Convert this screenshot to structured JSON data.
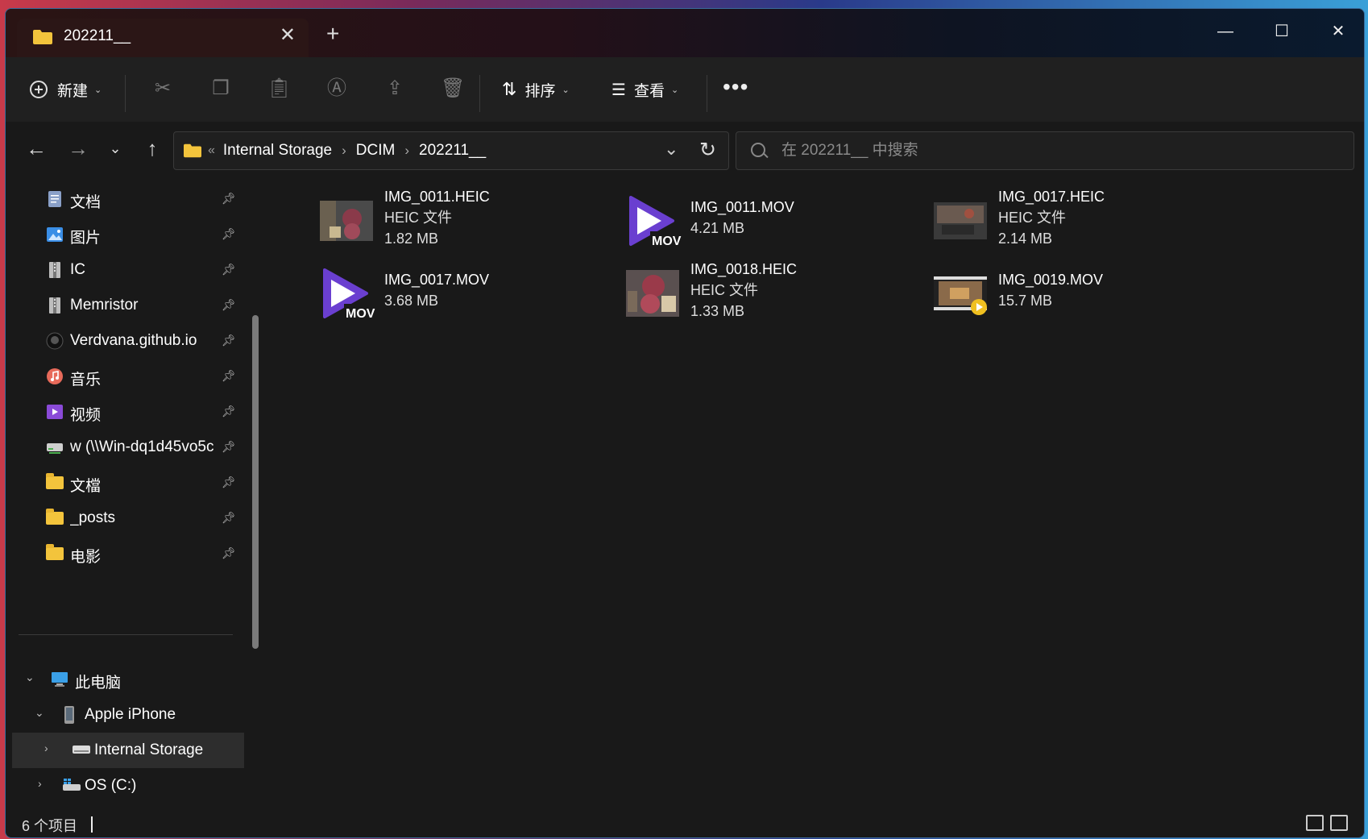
{
  "window": {
    "tab_title": "202211__",
    "new_tab_label": "+",
    "close_tab_label": "✕",
    "minimize_label": "—",
    "maximize_label": "☐",
    "close_label": "✕"
  },
  "toolbar": {
    "new_label": "新建",
    "sort_label": "排序",
    "view_label": "查看",
    "more_label": "•••",
    "icons": [
      "cut-icon",
      "copy-icon",
      "paste-icon",
      "rename-icon",
      "share-icon",
      "delete-icon"
    ]
  },
  "address": {
    "overflow": "«",
    "crumbs": [
      "Internal Storage",
      "DCIM",
      "202211__"
    ],
    "sep": "›"
  },
  "search": {
    "placeholder": "在 202211__ 中搜索"
  },
  "sidebar": {
    "quick_access": [
      {
        "label": "文档",
        "icon": "documents-icon"
      },
      {
        "label": "图片",
        "icon": "pictures-icon"
      },
      {
        "label": "IC",
        "icon": "zip-icon"
      },
      {
        "label": "Memristor",
        "icon": "zip-icon"
      },
      {
        "label": "Verdvana.github.io",
        "icon": "github-icon"
      },
      {
        "label": "音乐",
        "icon": "music-icon"
      },
      {
        "label": "视频",
        "icon": "videos-icon"
      },
      {
        "label": "w (\\\\Win-dq1d45vo5c",
        "icon": "network-drive-icon"
      },
      {
        "label": "文檔",
        "icon": "folder-icon"
      },
      {
        "label": "_posts",
        "icon": "folder-icon"
      },
      {
        "label": "电影",
        "icon": "folder-icon"
      }
    ],
    "tree": {
      "this_pc": "此电脑",
      "device": "Apple iPhone",
      "storage": "Internal Storage",
      "os": "OS (C:)"
    }
  },
  "files": [
    {
      "name": "IMG_0011.HEIC",
      "type": "HEIC 文件",
      "size": "1.82 MB",
      "kind": "image"
    },
    {
      "name": "IMG_0011.MOV",
      "type": "",
      "size": "4.21 MB",
      "kind": "mov"
    },
    {
      "name": "IMG_0017.HEIC",
      "type": "HEIC 文件",
      "size": "2.14 MB",
      "kind": "image"
    },
    {
      "name": "IMG_0017.MOV",
      "type": "",
      "size": "3.68 MB",
      "kind": "mov"
    },
    {
      "name": "IMG_0018.HEIC",
      "type": "HEIC 文件",
      "size": "1.33 MB",
      "kind": "image"
    },
    {
      "name": "IMG_0019.MOV",
      "type": "",
      "size": "15.7 MB",
      "kind": "video"
    }
  ],
  "mov_badge": "MOV",
  "status": {
    "count": "6 个项目"
  },
  "colors": {
    "accent_purple": "#6a3fd0",
    "folder_yellow": "#f3c43c",
    "bg": "#191919"
  }
}
